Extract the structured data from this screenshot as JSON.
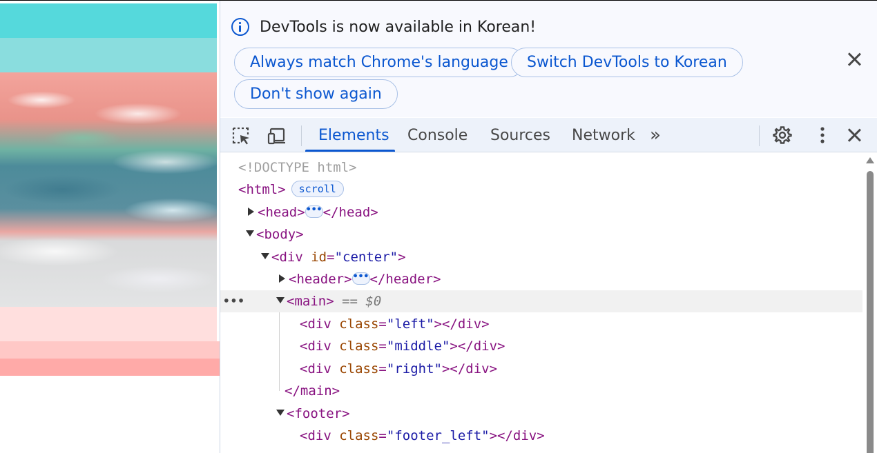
{
  "page": {
    "band_colors": [
      "#55d9dc",
      "#8addde",
      "#ffdfde",
      "#ffc8c6",
      "#ffaaa8"
    ],
    "image_description": "aerial ocean wave photo"
  },
  "devtools": {
    "infobar": {
      "message": "DevTools is now available in Korean!",
      "buttons": [
        "Always match Chrome's language",
        "Switch DevTools to Korean",
        "Don't show again"
      ]
    },
    "toolbar": {
      "tabs": [
        "Elements",
        "Console",
        "Sources",
        "Network"
      ],
      "active_tab": "Elements",
      "more_tabs": "»"
    },
    "tree": {
      "doctype": "<!DOCTYPE html>",
      "html_open": "<html>",
      "scroll_badge": "scroll",
      "head_open": "<head>",
      "head_close": "</head>",
      "body_open": "<body>",
      "div_open": "<div",
      "id_attr": "id",
      "id_val": "\"center\"",
      "header_open": "<header>",
      "header_close": "</header>",
      "main_open": "<main>",
      "selected_ref": "== $0",
      "div_tag": "<div",
      "class_attr": "class",
      "left_val": "\"left\"",
      "middle_val": "\"middle\"",
      "right_val": "\"right\"",
      "div_close": "></div>",
      "gt": ">",
      "eq": "=",
      "main_close": "</main>",
      "footer_open": "<footer>",
      "footer_left_val": "\"footer_left\"",
      "ellipsis": "•••",
      "row_menu": "•••"
    },
    "colors": {
      "accent": "#0b57d0",
      "tag": "#881280",
      "attribute": "#994500",
      "value": "#1a1aa6"
    }
  }
}
